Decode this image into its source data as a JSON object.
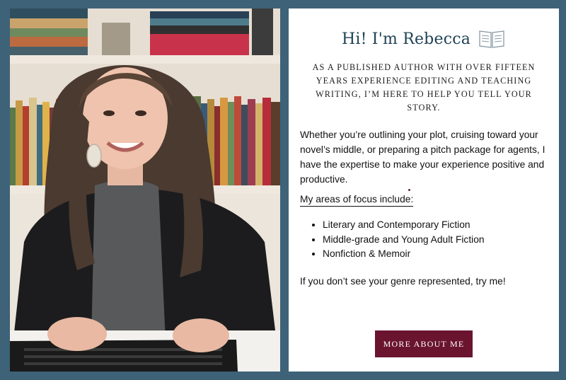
{
  "greeting": {
    "title": "Hi!  I'm Rebecca",
    "icon": "open-book-icon"
  },
  "subtitle": "AS A PUBLISHED AUTHOR WITH OVER FIFTEEN YEARS EXPERIENCE EDITING AND TEACHING WRITING, I’M HERE TO HELP YOU TELL YOUR STORY.",
  "intro": "Whether you’re outlining your plot, cruising toward your novel’s middle, or preparing a pitch package for agents, I have the expertise to make your experience positive and productive.",
  "focus": {
    "heading": "My areas of focus include:",
    "items": [
      "Literary and Contemporary Fiction",
      "Middle-grade and Young Adult Fiction",
      "Nonfiction & Memoir"
    ]
  },
  "closing": "If you don’t see your genre represented, try me!",
  "cta": {
    "label": "MORE ABOUT ME"
  },
  "colors": {
    "background": "#3e6278",
    "title": "#1f4255",
    "button": "#6a1430",
    "card": "#ffffff"
  }
}
